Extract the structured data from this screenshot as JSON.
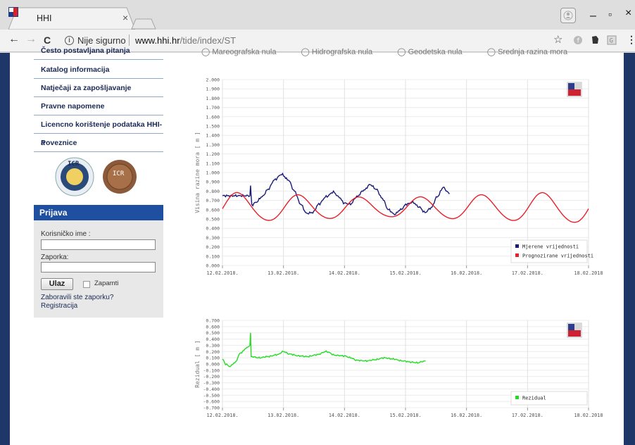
{
  "browser": {
    "tab_title": "HHI",
    "tab_close": "×",
    "nav": {
      "back": "←",
      "forward": "→",
      "reload": "C"
    },
    "security_label": "Nije sigurno",
    "url_host": "www.hhi.hr",
    "url_path": "/tide/index/ST",
    "window_controls": {
      "minimize": "–",
      "maximize": "▫",
      "close": "×"
    }
  },
  "sidebar": {
    "menu": [
      {
        "label": "Često postavljana pitanja"
      },
      {
        "label": "Katalog informacija"
      },
      {
        "label": "Natječaji za zapošljavanje"
      },
      {
        "label": "Pravne napomene"
      },
      {
        "label": "Licencno korištenje podataka HHI-a"
      },
      {
        "label": "Poveznice"
      }
    ],
    "badges": [
      "ICR",
      "ICR"
    ]
  },
  "login": {
    "title": "Prijava",
    "username_label": "Korisničko ime :",
    "password_label": "Zaporka:",
    "submit_label": "Ulaz",
    "remember_label": "Zapamti",
    "forgot_link": "Zaboravili ste zaporku?",
    "register_link": "Registracija"
  },
  "radio_options": [
    "Mareografska nula",
    "Hidrografska nula",
    "Geodetska nula",
    "Srednja razina mora"
  ],
  "colors": {
    "nav_blue": "#1f4fa0",
    "measured": "#1a1a7a",
    "predicted": "#e8202a",
    "residual": "#22dd22"
  },
  "chart_data": [
    {
      "type": "line",
      "ylabel": "Visina razine mora [ m ]",
      "ylim": [
        0,
        2.0
      ],
      "yticks": [
        "0.000",
        "0.100",
        "0.200",
        "0.300",
        "0.400",
        "0.500",
        "0.600",
        "0.700",
        "0.800",
        "0.900",
        "1.000",
        "1.100",
        "1.200",
        "1.300",
        "1.400",
        "1.500",
        "1.600",
        "1.700",
        "1.800",
        "1.900",
        "2.000"
      ],
      "xticks": [
        "12.02.2018.",
        "13.02.2018.",
        "14.02.2018.",
        "15.02.2018.",
        "16.02.2018.",
        "17.02.2018.",
        "18.02.2018"
      ],
      "xlim_days": [
        0,
        6
      ],
      "legend_position": "bottom-right",
      "grid": true,
      "series": [
        {
          "name": "Mjerene vrijednosti",
          "color": "#1a1a7a",
          "points": [
            [
              0,
              0.75
            ],
            [
              0.2,
              0.75
            ],
            [
              0.45,
              0.75
            ],
            [
              0.46,
              0.86
            ],
            [
              0.48,
              0.65
            ],
            [
              0.55,
              0.68
            ],
            [
              0.65,
              0.74
            ],
            [
              0.75,
              0.82
            ],
            [
              0.85,
              0.92
            ],
            [
              0.97,
              0.98
            ],
            [
              1.08,
              0.92
            ],
            [
              1.18,
              0.8
            ],
            [
              1.28,
              0.66
            ],
            [
              1.38,
              0.56
            ],
            [
              1.48,
              0.57
            ],
            [
              1.58,
              0.66
            ],
            [
              1.7,
              0.74
            ],
            [
              1.82,
              0.79
            ],
            [
              1.9,
              0.74
            ],
            [
              2.0,
              0.67
            ],
            [
              2.1,
              0.66
            ],
            [
              2.2,
              0.74
            ],
            [
              2.32,
              0.81
            ],
            [
              2.42,
              0.87
            ],
            [
              2.52,
              0.82
            ],
            [
              2.62,
              0.72
            ],
            [
              2.72,
              0.6
            ],
            [
              2.82,
              0.55
            ],
            [
              2.92,
              0.6
            ],
            [
              3.02,
              0.66
            ],
            [
              3.12,
              0.68
            ],
            [
              3.22,
              0.63
            ],
            [
              3.32,
              0.57
            ],
            [
              3.42,
              0.62
            ],
            [
              3.52,
              0.74
            ],
            [
              3.62,
              0.84
            ],
            [
              3.68,
              0.8
            ],
            [
              3.72,
              0.77
            ]
          ]
        },
        {
          "name": "Prognozirane vrijednosti",
          "color": "#e8202a",
          "period_days": 1.0,
          "phase_days": 0.25,
          "mean": 0.62,
          "amp_start": 0.16,
          "amp_mid": 0.1,
          "amp_end": 0.17
        }
      ]
    },
    {
      "type": "line",
      "ylabel": "Rezidual [ m ]",
      "ylim": [
        -0.7,
        0.7
      ],
      "yticks": [
        "0.700",
        "0.600",
        "0.500",
        "0.400",
        "0.300",
        "0.200",
        "0.100",
        "0.000",
        "-0.100",
        "-0.200",
        "-0.300",
        "-0.400",
        "-0.500",
        "-0.600",
        "-0.700"
      ],
      "xticks": [
        "12.02.2018.",
        "13.02.2018.",
        "14.02.2018.",
        "15.02.2018.",
        "16.02.2018.",
        "17.02.2018.",
        "18.02.2018"
      ],
      "xlim_days": [
        0,
        6
      ],
      "legend_position": "bottom-right",
      "grid": true,
      "series": [
        {
          "name": "Rezidual",
          "color": "#22dd22",
          "points": [
            [
              0,
              0.08
            ],
            [
              0.05,
              0.0
            ],
            [
              0.12,
              -0.04
            ],
            [
              0.2,
              0.02
            ],
            [
              0.3,
              0.18
            ],
            [
              0.4,
              0.26
            ],
            [
              0.45,
              0.3
            ],
            [
              0.46,
              0.5
            ],
            [
              0.47,
              0.12
            ],
            [
              0.6,
              0.1
            ],
            [
              0.75,
              0.12
            ],
            [
              0.9,
              0.15
            ],
            [
              1.0,
              0.2
            ],
            [
              1.1,
              0.16
            ],
            [
              1.25,
              0.13
            ],
            [
              1.4,
              0.12
            ],
            [
              1.55,
              0.15
            ],
            [
              1.7,
              0.2
            ],
            [
              1.85,
              0.14
            ],
            [
              2.0,
              0.13
            ],
            [
              2.1,
              0.1
            ],
            [
              2.2,
              0.06
            ],
            [
              2.35,
              0.05
            ],
            [
              2.5,
              0.07
            ],
            [
              2.65,
              0.1
            ],
            [
              2.8,
              0.08
            ],
            [
              2.95,
              0.05
            ],
            [
              3.1,
              0.03
            ],
            [
              3.2,
              0.02
            ],
            [
              3.28,
              0.04
            ],
            [
              3.33,
              0.05
            ]
          ]
        }
      ]
    }
  ]
}
